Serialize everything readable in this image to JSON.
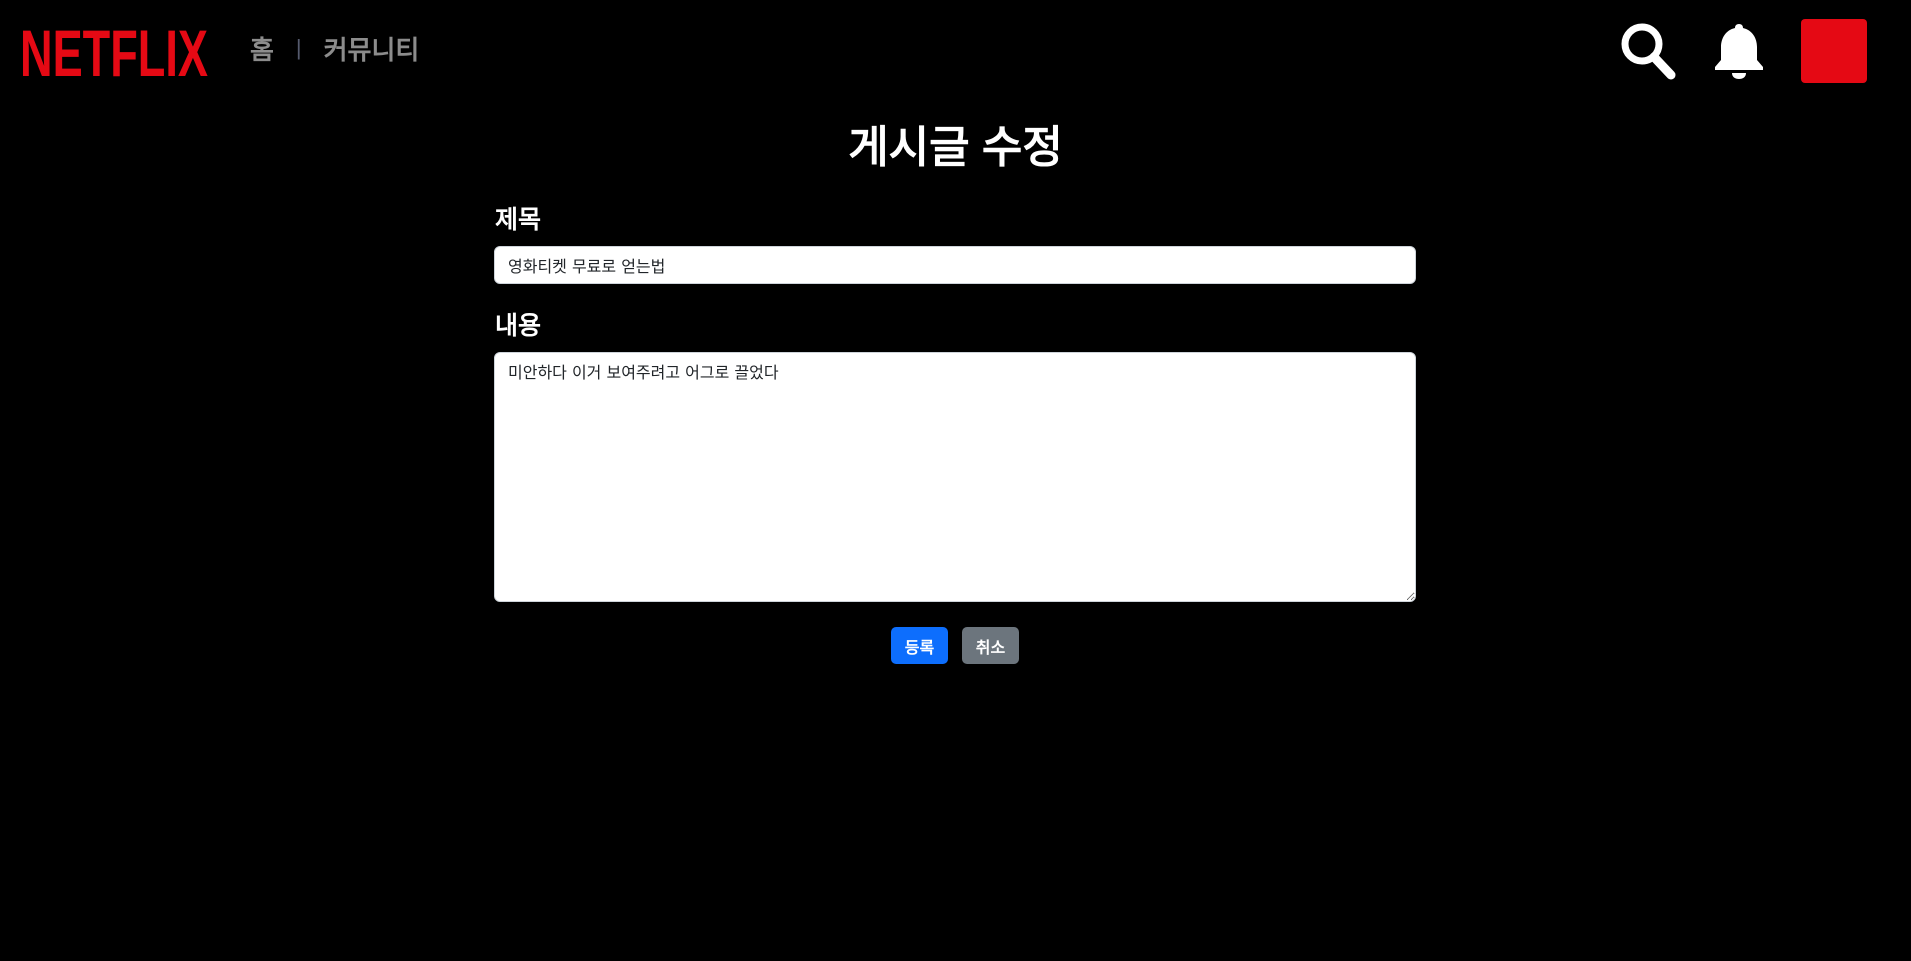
{
  "header": {
    "logo_text": "NETFLIX",
    "nav": {
      "home": "홈",
      "separator": "|",
      "community": "커뮤니티"
    },
    "icons": {
      "search": "search-icon",
      "notifications": "bell-icon"
    }
  },
  "colors": {
    "brand": "#e50914",
    "background": "#000000",
    "nav_text": "#8c8c8c",
    "primary_button": "#0d6efd",
    "secondary_button": "#6c757d"
  },
  "form": {
    "heading": "게시글 수정",
    "title_label": "제목",
    "title_value": "영화티켓 무료로 얻는법",
    "content_label": "내용",
    "content_value": "미안하다 이거 보여주려고 어그로 끌었다",
    "submit_label": "등록",
    "cancel_label": "취소"
  }
}
